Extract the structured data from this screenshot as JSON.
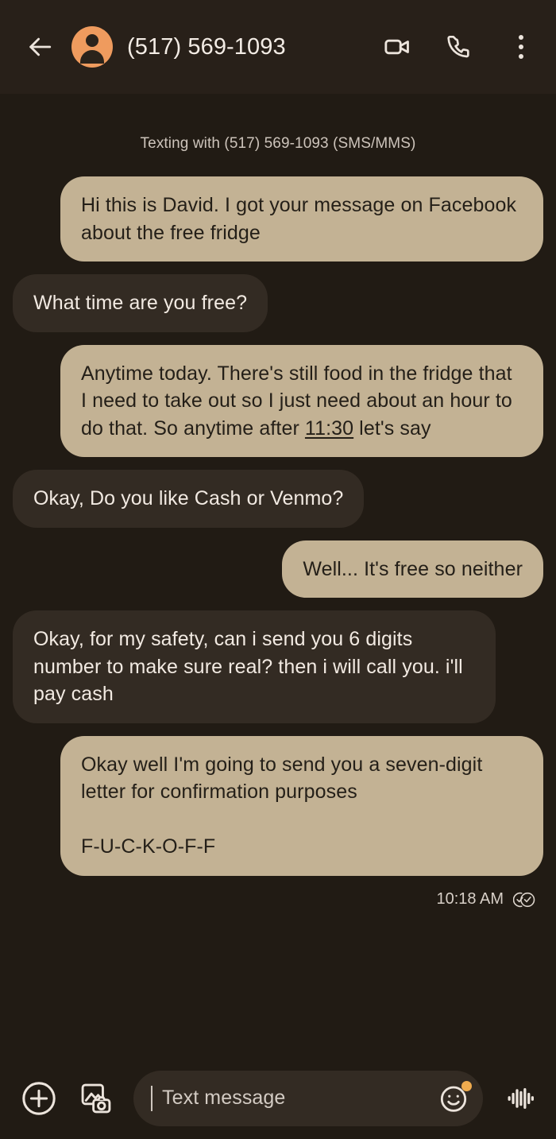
{
  "header": {
    "back_icon": "arrow-left-icon",
    "avatar_icon": "contact-avatar-icon",
    "avatar_color": "#ef9b5e",
    "title": "(517) 569-1093",
    "video_call_icon": "video-camera-icon",
    "voice_call_icon": "phone-icon",
    "overflow_icon": "more-vertical-icon"
  },
  "thread": {
    "subtitle": "Texting with (517) 569-1093 (SMS/MMS)",
    "messages": [
      {
        "direction": "sent",
        "text": "Hi this is David. I got your message on Facebook about the free fridge"
      },
      {
        "direction": "received",
        "text": "What time are you free?"
      },
      {
        "direction": "sent",
        "text_before": "Anytime today. There's still food in the fridge that I need to take out so I just need about an hour to do that. So anytime after ",
        "link_text": "11:30",
        "text_after": " let's say"
      },
      {
        "direction": "received",
        "text": "Okay, Do you like Cash or Venmo?"
      },
      {
        "direction": "sent",
        "text": "Well... It's free so neither"
      },
      {
        "direction": "received",
        "text": "Okay, for my safety, can i send you 6 digits number to make sure real? then i will call you. i'll pay cash"
      },
      {
        "direction": "sent",
        "text": "Okay well I'm going to send you a seven-digit letter for confirmation purposes\n\nF-U-C-K-O-F-F"
      }
    ],
    "status": {
      "timestamp": "10:18 AM",
      "delivery_icon": "delivered-double-check-icon"
    }
  },
  "composer": {
    "add_icon": "plus-circle-icon",
    "gallery_icon": "image-camera-icon",
    "placeholder": "Text message",
    "emoji_icon": "emoji-smiley-icon",
    "emoji_badge_color": "#efab4e",
    "audio_icon": "audio-waveform-icon"
  },
  "colors": {
    "background": "#211b14",
    "header_background": "#282019",
    "sent_bubble": "#c3b294",
    "received_bubble": "#332b23",
    "accent": "#ef9b5e"
  }
}
